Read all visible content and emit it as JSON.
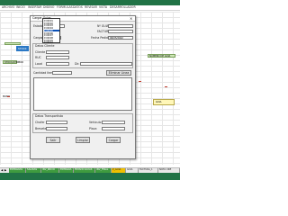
{
  "ribbon": {
    "tabs": [
      "ARCHIVO",
      "INICIO",
      "INSERTAR",
      "DISEÑO",
      "FORMULAS",
      "DATOS",
      "REVISAR",
      "VISTA",
      "DESARROLLADOR"
    ]
  },
  "sheet": {
    "labels": {
      "stock_button": "STOCK",
      "left_label": "STOCK/ATRIBOR",
      "right_label": "NUMERO DE GUIA",
      "side_left": "MONE",
      "side_right": "GUIA"
    }
  },
  "dialog": {
    "title": "Cargar Guias",
    "estado_label": "Estado",
    "estado_value": "PENDIENTE",
    "n_guia_label": "Nº GUIA",
    "factura_label": "FACTURA",
    "cargar_pedido_label": "Cargar Pedido",
    "fecha_pedido_label": "Fecha Pedido",
    "fecha_pedido_value": "06/05/2022",
    "datos_cliente_title": "Datos Cliente",
    "cliente_label": "Cliente",
    "ruc_label": "RUC",
    "local_label": "Local",
    "dir_label": "Dir.",
    "cantidad_items_label": "Cantidad Items",
    "eliminar_linea_label": "Eliminar Linea",
    "datos_transportista_title": "Datos Transportista",
    "chofer_label": "Chofer",
    "vehiculo_label": "Vehiculo",
    "brevete_label": "Brevete",
    "placa_label": "Placa",
    "salir_label": "Salir",
    "limpiar_label": "Limpiar",
    "cargar_label": "Cargar"
  },
  "dropdown": {
    "options": [
      "P-00001",
      "P-00002",
      "P-00003",
      "P-00004",
      "P-00005",
      "P-00006",
      "P-00007",
      "P-00008",
      "P-00009",
      "P-00010"
    ],
    "selected_index": 4
  },
  "sheet_tabs": [
    {
      "label": "ENTRADAS",
      "color": "#3f9b3f"
    },
    {
      "label": "SALIDAS",
      "color": "#3f9b3f"
    },
    {
      "label": "INV_INICIO",
      "color": "#3f9b3f"
    },
    {
      "label": "ENTRADA",
      "color": "#3f9b3f"
    },
    {
      "label": "ESTADO GUIAS",
      "color": "#3f9b3f"
    },
    {
      "label": "INV_FINAL",
      "color": "#3f9b3f"
    },
    {
      "label": "P_GUIA",
      "color": "#f0c000"
    },
    {
      "label": "GUIA",
      "color": "#e8e8e8"
    },
    {
      "label": "FACTURA_1",
      "color": "#e8e8e8"
    },
    {
      "label": "NOTA CRE",
      "color": "#e8e8e8"
    }
  ],
  "colors": {
    "excel_green": "#217346",
    "dropdown_selected": "#0a4fb5"
  }
}
